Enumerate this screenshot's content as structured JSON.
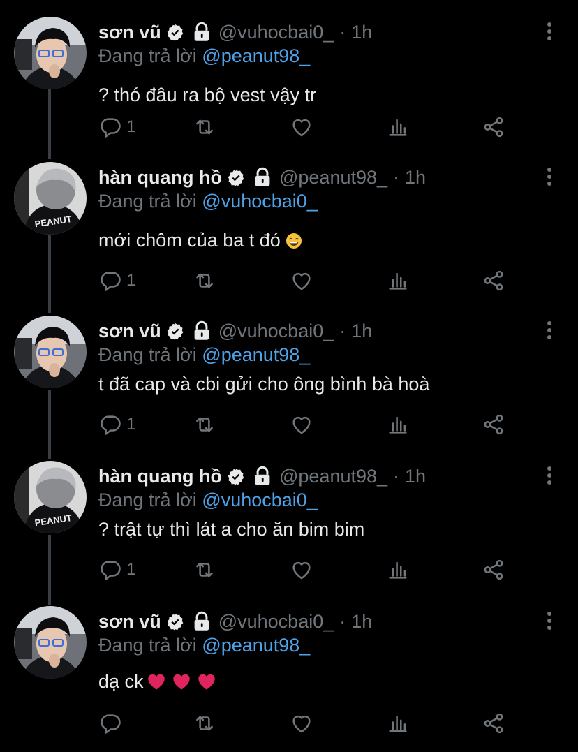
{
  "colors": {
    "background": "#000000",
    "text": "#e7e9ea",
    "muted": "#71767b",
    "mention": "#4ea3e8",
    "thread_line": "#3a3d41",
    "heart": "#e0245e"
  },
  "icons": {
    "verified": "verified-badge-icon",
    "lock": "lock-icon",
    "more": "more-vertical-icon",
    "reply": "reply-icon",
    "retweet": "retweet-icon",
    "like": "heart-icon",
    "views": "views-chart-icon",
    "share": "share-icon"
  },
  "reply_prefix": "Đang trả lời",
  "separator": "·",
  "tweets": [
    {
      "name": "sơn vũ",
      "handle": "@vuhocbai0_",
      "time": "1h",
      "reply_to": "@peanut98_",
      "text": "? thó đâu ra bộ vest vậy tr",
      "emoji": "",
      "reply_count": "1"
    },
    {
      "name": "hàn quang hồ",
      "handle": "@peanut98_",
      "time": "1h",
      "reply_to": "@vuhocbai0_",
      "text": "mới chôm của ba t đó",
      "emoji": "sweat-smile",
      "reply_count": "1"
    },
    {
      "name": "sơn vũ",
      "handle": "@vuhocbai0_",
      "time": "1h",
      "reply_to": "@peanut98_",
      "text": "t đã cap và cbi gửi cho ông bình bà hoà",
      "emoji": "",
      "reply_count": "1"
    },
    {
      "name": "hàn quang hồ",
      "handle": "@peanut98_",
      "time": "1h",
      "reply_to": "@vuhocbai0_",
      "text": "? trật tự thì lát a cho ăn bim bim",
      "emoji": "",
      "reply_count": "1"
    },
    {
      "name": "sơn vũ",
      "handle": "@vuhocbai0_",
      "time": "1h",
      "reply_to": "@peanut98_",
      "text": "dạ ck",
      "emoji": "hearts",
      "reply_count": ""
    }
  ]
}
